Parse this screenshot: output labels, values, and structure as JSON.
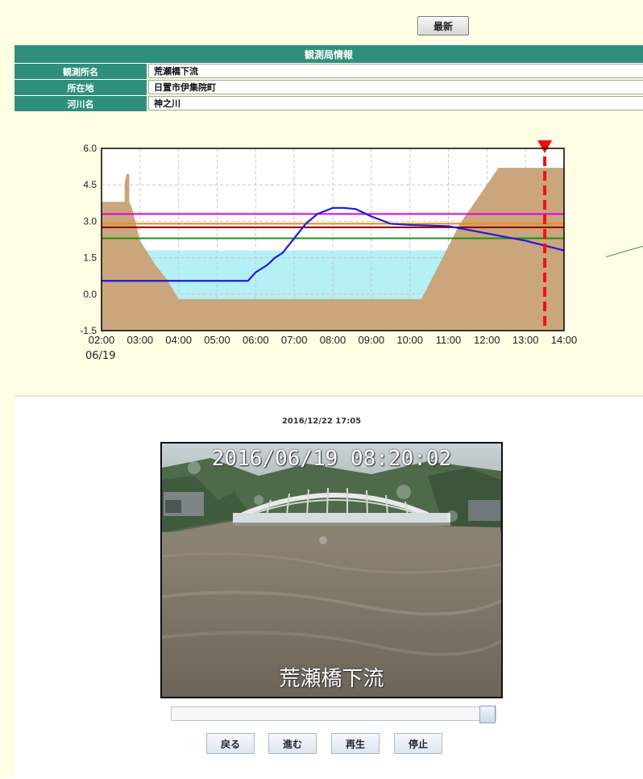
{
  "toolbar": {
    "refresh_label": "最新"
  },
  "station_info": {
    "header": "観測局情報",
    "rows": [
      {
        "label": "観測所名",
        "value": "荒瀬橋下流"
      },
      {
        "label": "所在地",
        "value": "日置市伊集院町"
      },
      {
        "label": "河川名",
        "value": "神之川"
      }
    ]
  },
  "chart_data": {
    "type": "line",
    "date_label": "06/19",
    "x_ticks": [
      "02:00",
      "03:00",
      "04:00",
      "05:00",
      "06:00",
      "07:00",
      "08:00",
      "09:00",
      "10:00",
      "11:00",
      "12:00",
      "13:00",
      "14:00"
    ],
    "y_ticks": [
      "6.0",
      "4.5",
      "3.0",
      "1.5",
      "0.0",
      "-1.5"
    ],
    "ylim": [
      -1.5,
      6.0
    ],
    "xlim_hours": [
      2,
      14
    ],
    "grid": true,
    "threshold_lines": [
      {
        "level": 3.3,
        "color": "#e000e0"
      },
      {
        "level": 2.9,
        "color": "#f08c00"
      },
      {
        "level": 2.75,
        "color": "#8b0000"
      },
      {
        "level": 2.3,
        "color": "#119911"
      }
    ],
    "current_time_hours": 13.5,
    "cross_section_bank": [
      [
        2.0,
        3.8
      ],
      [
        2.6,
        3.8
      ],
      [
        2.6,
        4.6
      ],
      [
        2.65,
        4.95
      ],
      [
        2.72,
        4.95
      ],
      [
        2.72,
        3.8
      ],
      [
        2.8,
        3.5
      ],
      [
        3.0,
        2.2
      ],
      [
        3.4,
        1.2
      ],
      [
        3.7,
        0.6
      ],
      [
        4.0,
        -0.2
      ],
      [
        10.3,
        -0.2
      ],
      [
        11.3,
        2.9
      ],
      [
        12.3,
        5.2
      ],
      [
        14.0,
        5.2
      ]
    ],
    "cross_section_water_level": 1.8,
    "series": [
      {
        "color": "#1c1cdd",
        "x": [
          2.0,
          5.8,
          6.0,
          6.3,
          6.5,
          6.7,
          7.0,
          7.3,
          7.6,
          8.0,
          8.3,
          8.6,
          9.0,
          9.5,
          10.0,
          11.0,
          12.0,
          13.0,
          14.0
        ],
        "y": [
          0.55,
          0.55,
          0.9,
          1.2,
          1.5,
          1.7,
          2.3,
          2.9,
          3.3,
          3.55,
          3.55,
          3.5,
          3.2,
          2.9,
          2.85,
          2.8,
          2.5,
          2.2,
          1.8
        ]
      }
    ]
  },
  "camera": {
    "last_update": "2016/12/22 17:05",
    "timestamp_overlay": "2016/06/19  08:20:02",
    "location_overlay": "荒瀬橋下流",
    "slider_position": 1.0
  },
  "controls": {
    "back_label": "戻る",
    "forward_label": "進む",
    "play_label": "再生",
    "stop_label": "停止"
  }
}
